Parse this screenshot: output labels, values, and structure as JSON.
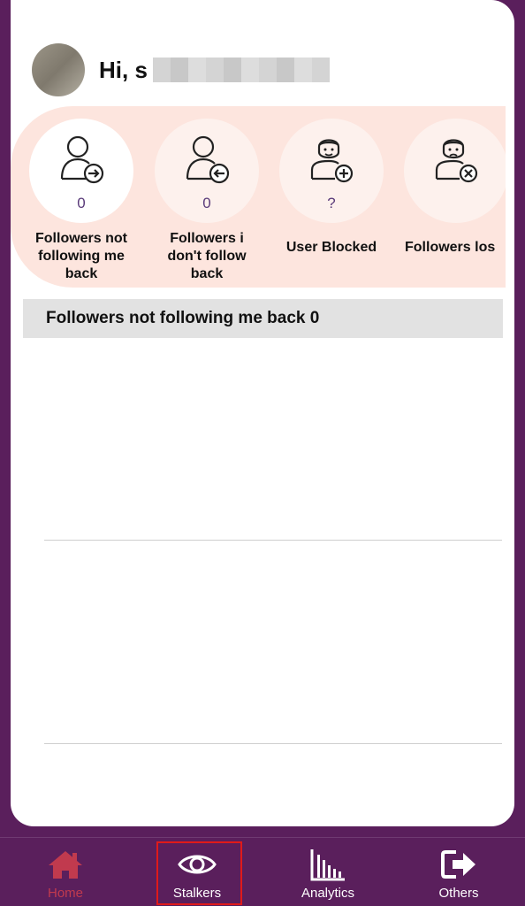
{
  "greeting": "Hi, s",
  "stats": [
    {
      "count": "0",
      "label": "Followers not following me back"
    },
    {
      "count": "0",
      "label": "Followers i don't follow back"
    },
    {
      "count": "?",
      "label": "User Blocked"
    },
    {
      "count": "",
      "label": "Followers los"
    }
  ],
  "section_title": "Followers not following me back 0",
  "nav": [
    {
      "label": "Home",
      "icon": "home-icon"
    },
    {
      "label": "Stalkers",
      "icon": "eye-icon"
    },
    {
      "label": "Analytics",
      "icon": "analytics-icon"
    },
    {
      "label": "Others",
      "icon": "logout-icon"
    }
  ],
  "colors": {
    "background": "#5a1f5c",
    "stats_band": "#fde5de",
    "active_nav": "#c13a4e",
    "highlight": "#e01a1a"
  }
}
